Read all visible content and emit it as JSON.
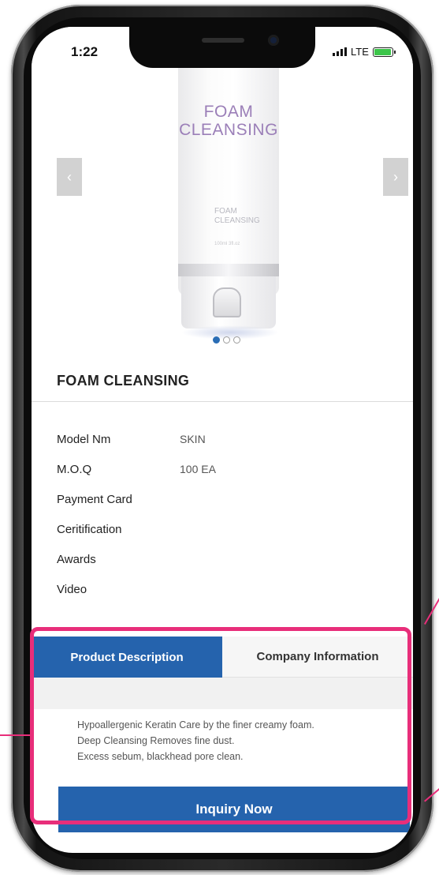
{
  "status_bar": {
    "time": "1:22",
    "network": "LTE",
    "battery_level": 0.86
  },
  "product": {
    "image_label": "FOAM CLEANSING",
    "image_small_label": "FOAM CLEANSING",
    "image_tiny_label": "100ml 3fl.oz",
    "title": "FOAM CLEANSING",
    "carousel": {
      "prev_icon": "‹",
      "next_icon": "›",
      "active_slide": 1,
      "total_slides": 3
    },
    "specs": [
      {
        "label": "Model Nm",
        "value": "SKIN"
      },
      {
        "label": "M.O.Q",
        "value": "100 EA"
      },
      {
        "label": "Payment Card",
        "value": ""
      },
      {
        "label": "Ceritification",
        "value": ""
      },
      {
        "label": "Awards",
        "value": ""
      },
      {
        "label": "Video",
        "value": ""
      }
    ]
  },
  "tabs": {
    "product_description": "Product Description",
    "company_information": "Company Information"
  },
  "description": {
    "line1": "Hypoallergenic Keratin Care by the finer creamy foam.",
    "line2": "Deep Cleansing Removes fine dust.",
    "line3": "Excess sebum, blackhead pore clean."
  },
  "inquiry_button": "Inquiry Now",
  "colors": {
    "accent_blue": "#2563ad",
    "highlight_pink": "#e82e7a",
    "brand_purple": "#9b7fb8"
  }
}
